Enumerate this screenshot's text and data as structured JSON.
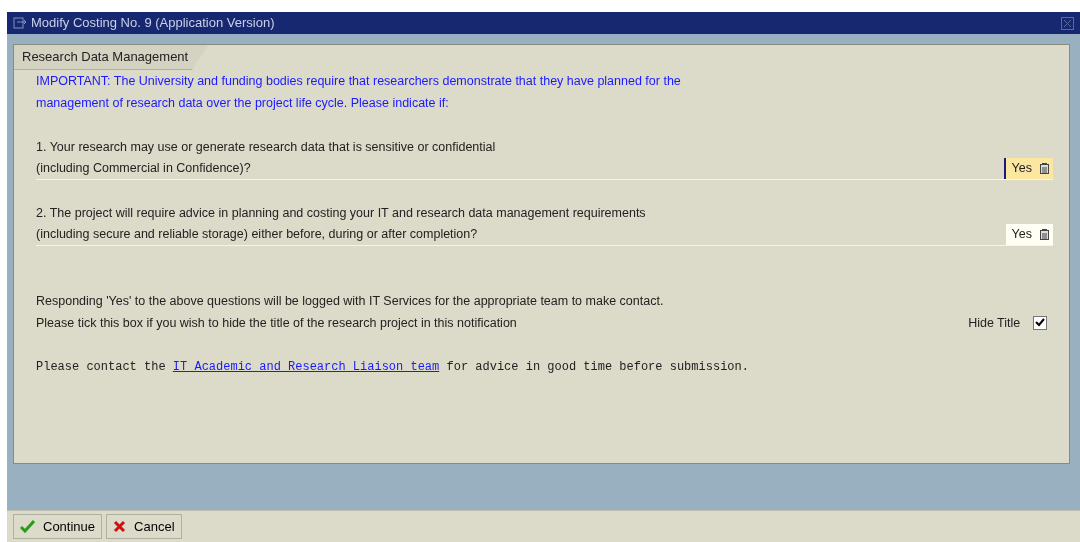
{
  "window": {
    "title": "Modify Costing No. 9 (Application Version)"
  },
  "tab": {
    "label": "Research Data Management"
  },
  "notice": [
    "IMPORTANT: The University and funding bodies require that researchers demonstrate that they have planned for the",
    "management of research data over the project life cycle. Please indicate if:"
  ],
  "questions": [
    {
      "lines": [
        "1. Your research may use or generate research data that is sensitive or confidential",
        "(including Commercial in Confidence)?"
      ],
      "answer": "Yes",
      "focused": true
    },
    {
      "lines": [
        "2. The project will require advice in planning and costing your IT and research data management requirements",
        "(including secure and reliable storage) either before, during or after completion?"
      ],
      "answer": "Yes",
      "focused": false
    }
  ],
  "info": "Responding 'Yes' to the above questions will be logged with IT Services for the appropriate team to make contact.",
  "hide_title": {
    "prompt": "Please tick this box if you wish to hide the title of the research project in this notification",
    "label": "Hide Title",
    "checked": true
  },
  "contact": {
    "before": "Please contact the ",
    "link": "IT Academic and Research Liaison team",
    "after": " for advice in good time before submission."
  },
  "buttons": [
    {
      "label": "Continue",
      "kind": "ok"
    },
    {
      "label": "Cancel",
      "kind": "cancel"
    }
  ]
}
